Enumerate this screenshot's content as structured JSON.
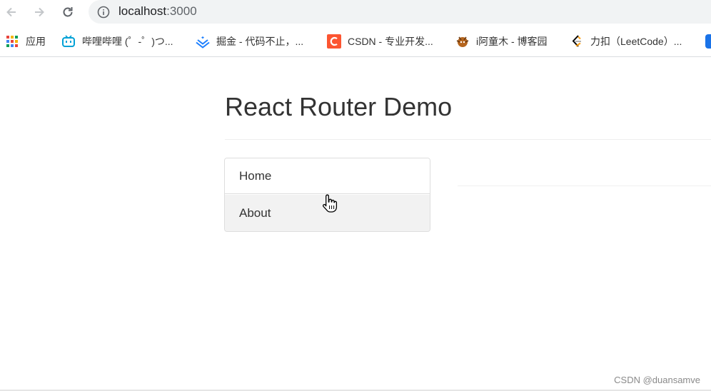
{
  "browser": {
    "url_host": "localhost",
    "url_port": ":3000",
    "icons": [
      "back-icon",
      "forward-icon",
      "reload-icon",
      "info-icon"
    ]
  },
  "bookmarks": [
    {
      "label": "应用",
      "icon": "apps-grid-icon"
    },
    {
      "label": "哔哩哔哩 (゜-゜)つ...",
      "icon": "bilibili-icon"
    },
    {
      "label": "掘金 - 代码不止，...",
      "icon": "juejin-icon"
    },
    {
      "label": "CSDN - 专业开发...",
      "icon": "csdn-icon"
    },
    {
      "label": "i阿童木 - 博客园",
      "icon": "cnblogs-icon"
    },
    {
      "label": "力扣（LeetCode）...",
      "icon": "leetcode-icon"
    }
  ],
  "page": {
    "title": "React Router Demo",
    "nav": [
      {
        "label": "Home"
      },
      {
        "label": "About"
      }
    ]
  },
  "watermark": "CSDN @duansamve",
  "colors": {
    "csdn": "#fc5531",
    "bilibili": "#00a1d6",
    "juejin": "#1e80ff",
    "active_item_bg": "#f2f2f2"
  }
}
